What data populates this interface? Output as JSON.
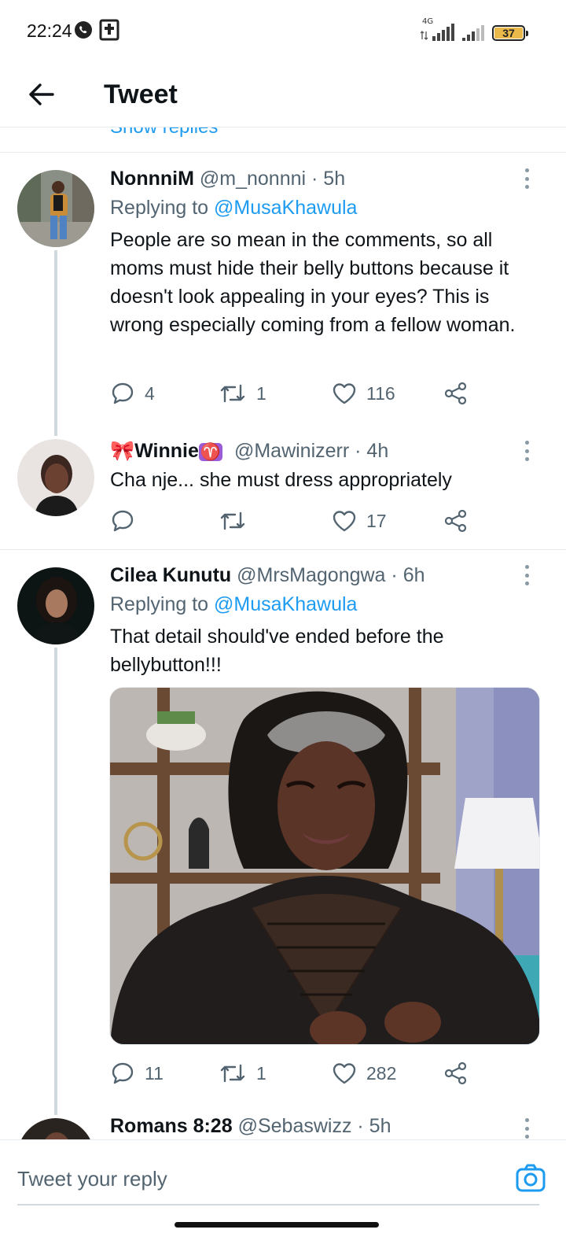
{
  "status_bar": {
    "time": "22:24",
    "network": "4G",
    "battery": "37",
    "icons": [
      "whatsapp-icon",
      "bible-app-icon",
      "signal-icon",
      "battery-icon"
    ]
  },
  "header": {
    "title": "Tweet",
    "back_icon": "arrow-left-icon"
  },
  "show_replies_label": "Show replies",
  "tweets": [
    {
      "name": "NonnniM",
      "handle": "@m_nonnni",
      "time": "· 5h",
      "replying_prefix": "Replying to",
      "replying_handle": "@MusaKhawula",
      "text": "People are so mean in the comments, so all moms must hide their belly buttons because it doesn't look appealing in your eyes? This is wrong especially coming from a fellow woman.",
      "replies": "4",
      "retweets": "1",
      "likes": "116"
    },
    {
      "name_prefix_emoji": "🎀",
      "name": "Winnie",
      "name_suffix_emoji": "♈",
      "handle": "@Mawinizerr",
      "time": "· 4h",
      "text": "Cha nje... she must dress appropriately",
      "replies": "",
      "retweets": "",
      "likes": "17"
    },
    {
      "name": "Cilea Kunutu",
      "handle": "@MrsMagongwa",
      "time": "· 6h",
      "replying_prefix": "Replying to",
      "replying_handle": "@MusaKhawula",
      "text": "That detail should've ended before the bellybutton!!!",
      "media": "photo of a woman in a black top with a pained expression",
      "replies": "11",
      "retweets": "1",
      "likes": "282"
    },
    {
      "name": "Romans 8:28",
      "handle": "@Sebaswizz",
      "time": "· 5h"
    }
  ],
  "composer": {
    "placeholder": "Tweet your reply",
    "camera_icon": "camera-icon"
  },
  "colors": {
    "accent": "#1d9bf0",
    "text_primary": "#0f1419",
    "text_secondary": "#536471",
    "divider": "#e6ecf0",
    "thread_line": "#cfd9de"
  }
}
